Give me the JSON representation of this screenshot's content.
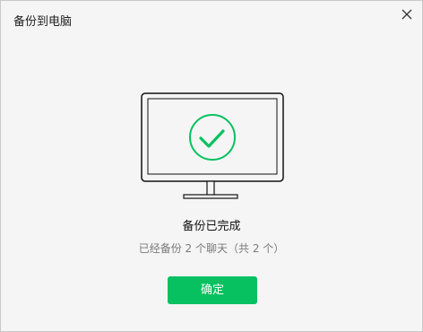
{
  "window": {
    "title": "备份到电脑"
  },
  "controls": {
    "close_icon": "close-icon"
  },
  "illustration": {
    "icon": "monitor-check-icon",
    "accent_color": "#07c160"
  },
  "status": {
    "title": "备份已完成",
    "subtitle": "已经备份 2 个聊天（共 2 个）"
  },
  "actions": {
    "confirm_label": "确定"
  }
}
